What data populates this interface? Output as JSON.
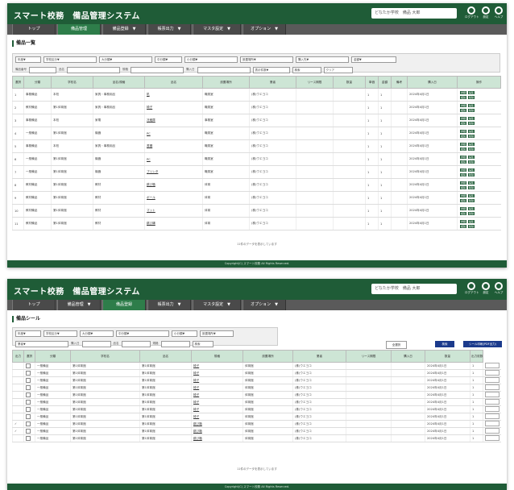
{
  "colors": {
    "header": "#1f5c37",
    "nav": "#5a5a5a",
    "active_tab": "#2e7d4a",
    "table_header": "#cde5d5"
  },
  "shot1": {
    "app_title": "スマート校務　備品管理システム",
    "user_field": "どなたか学校　備品 大郎",
    "header_icons": [
      {
        "name": "logout-icon",
        "label": "ログアウト"
      },
      {
        "name": "settings-icon",
        "label": "設定"
      },
      {
        "name": "help-icon",
        "label": "ヘルプ"
      }
    ],
    "tabs": [
      {
        "label": "トップ"
      },
      {
        "label": "備品管理",
        "active": true
      },
      {
        "label": "備品登録　▼"
      },
      {
        "label": "帳票出力　▼"
      },
      {
        "label": "マスタ設定　▼"
      },
      {
        "label": "オプション　▼"
      }
    ],
    "page_title": "備品一覧",
    "filters_row1": [
      "年度▼",
      "学校区分▼",
      "大分類▼",
      "中分類▼",
      "小分類▼",
      "設置場所▼",
      "購入先▼",
      "金額▼"
    ],
    "filters_row2": [
      "備品番号",
      "品名",
      "規格",
      "購入日",
      "表示件数▼",
      "検索",
      "クリア"
    ],
    "columns": [
      "選択",
      "分類",
      "学校名",
      "品名/規格",
      "品名",
      "設置場所",
      "業者",
      "リース期限",
      "数量",
      "単価",
      "金額",
      "備考",
      "購入日",
      "操作"
    ],
    "rows": [
      {
        "no": "1",
        "cat": "事務備品",
        "school": "本校",
        "model": "家具・事務用品",
        "name": "机",
        "place": "職員室",
        "vendor": "(株)ウエヨコ",
        "qty": "1",
        "price": "1",
        "date": "2024年4月1日"
      },
      {
        "no": "2",
        "cat": "教材備品",
        "school": "第1体育館",
        "model": "家具・事務用品",
        "name": "椅子",
        "place": "職員室",
        "vendor": "(株)ウエヨコ",
        "qty": "1",
        "price": "1",
        "date": "2024年4月1日"
      },
      {
        "no": "3",
        "cat": "事務備品",
        "school": "本校",
        "model": "家電",
        "name": "冷蔵庫",
        "place": "事務室",
        "vendor": "(株)ウエヨコ",
        "qty": "1",
        "price": "1",
        "date": "2024年4月1日"
      },
      {
        "no": "4",
        "cat": "一般備品",
        "school": "第1体育館",
        "model": "機器",
        "name": "PC",
        "place": "職員室",
        "vendor": "(株)ウエヨコ",
        "qty": "1",
        "price": "1",
        "date": "2024年4月1日"
      },
      {
        "no": "5",
        "cat": "事務備品",
        "school": "本校",
        "model": "家具・事務用品",
        "name": "書棚",
        "place": "職員室",
        "vendor": "(株)ウエヨコ",
        "qty": "1",
        "price": "1",
        "date": "2024年4月1日"
      },
      {
        "no": "6",
        "cat": "一般備品",
        "school": "第1体育館",
        "model": "機器",
        "name": "PC",
        "place": "職員室",
        "vendor": "(株)ウエヨコ",
        "qty": "1",
        "price": "1",
        "date": "2024年4月1日"
      },
      {
        "no": "7",
        "cat": "一般備品",
        "school": "第1体育館",
        "model": "機器",
        "name": "プリンタ",
        "place": "職員室",
        "vendor": "(株)ウエヨコ",
        "qty": "1",
        "price": "1",
        "date": "2024年4月1日"
      },
      {
        "no": "8",
        "cat": "教材備品",
        "school": "第1体育館",
        "model": "教材",
        "name": "跳び箱",
        "place": "体育",
        "vendor": "(株)ウエヨコ",
        "qty": "1",
        "price": "1",
        "date": "2024年4月1日"
      },
      {
        "no": "9",
        "cat": "教材備品",
        "school": "第1体育館",
        "model": "教材",
        "name": "ボール",
        "place": "体育",
        "vendor": "(株)ウエヨコ",
        "qty": "1",
        "price": "1",
        "date": "2024年4月1日"
      },
      {
        "no": "10",
        "cat": "教材備品",
        "school": "第1体育館",
        "model": "教材",
        "name": "マット",
        "place": "体育",
        "vendor": "(株)ウエヨコ",
        "qty": "1",
        "price": "1",
        "date": "2024年4月1日"
      },
      {
        "no": "11",
        "cat": "教材備品",
        "school": "第1体育館",
        "model": "教材",
        "name": "跳び縄",
        "place": "体育",
        "vendor": "(株)ウエヨコ",
        "qty": "1",
        "price": "1",
        "date": "2024年4月1日"
      }
    ],
    "row_buttons": [
      "詳細",
      "編集",
      "複製",
      "削除"
    ],
    "count_text": "11件のデータを表示しています",
    "footer": "Copyright(C) スマート校務 All Rights Reserved."
  },
  "shot2": {
    "app_title": "スマート校務　備品管理システム",
    "user_field": "どなたか学校　備品 大郎",
    "tabs": [
      {
        "label": "トップ"
      },
      {
        "label": "備品管理　▼"
      },
      {
        "label": "備品登録",
        "active": true
      },
      {
        "label": "帳票出力　▼"
      },
      {
        "label": "マスタ設定　▼"
      },
      {
        "label": "オプション　▼"
      }
    ],
    "page_title": "備品シール",
    "filters_row1": [
      "年度▼",
      "学校区分▼",
      "大分類▼",
      "中分類▼",
      "小分類▼",
      "設置場所▼"
    ],
    "filters_row2": [
      "業者▼",
      "購入日",
      "品名",
      "規格",
      "検索"
    ],
    "action_buttons": {
      "clear": "全選択",
      "search": "検索",
      "print": "シール印刷(PDF出力)"
    },
    "columns": [
      "出力",
      "選択",
      "分類",
      "学校名",
      "品名",
      "規格",
      "設置場所",
      "業者",
      "リース期限",
      "購入日",
      "数量",
      "出力枚数"
    ],
    "rows": [
      {
        "sel": "",
        "cat": "一般備品",
        "school": "第1体育館",
        "model": "第1体育館",
        "name": "椅子",
        "place": "体育館",
        "vendor": "(株)ウエヨコ",
        "date": "2024年4月1日",
        "qty": "1"
      },
      {
        "sel": "",
        "cat": "一般備品",
        "school": "第1体育館",
        "model": "第1体育館",
        "name": "椅子",
        "place": "体育館",
        "vendor": "(株)ウエヨコ",
        "date": "2024年4月1日",
        "qty": "1"
      },
      {
        "sel": "",
        "cat": "一般備品",
        "school": "第1体育館",
        "model": "第1体育館",
        "name": "椅子",
        "place": "体育館",
        "vendor": "(株)ウエヨコ",
        "date": "2024年4月1日",
        "qty": "1"
      },
      {
        "sel": "",
        "cat": "一般備品",
        "school": "第1体育館",
        "model": "第1体育館",
        "name": "椅子",
        "place": "体育館",
        "vendor": "(株)ウエヨコ",
        "date": "2024年4月1日",
        "qty": "1"
      },
      {
        "sel": "",
        "cat": "一般備品",
        "school": "第1体育館",
        "model": "第1体育館",
        "name": "椅子",
        "place": "体育館",
        "vendor": "(株)ウエヨコ",
        "date": "2024年4月1日",
        "qty": "1"
      },
      {
        "sel": "",
        "cat": "一般備品",
        "school": "第1体育館",
        "model": "第1体育館",
        "name": "椅子",
        "place": "体育館",
        "vendor": "(株)ウエヨコ",
        "date": "2024年4月1日",
        "qty": "1"
      },
      {
        "sel": "",
        "cat": "一般備品",
        "school": "第1体育館",
        "model": "第1体育館",
        "name": "椅子",
        "place": "体育館",
        "vendor": "(株)ウエヨコ",
        "date": "2024年4月1日",
        "qty": "1"
      },
      {
        "sel": "",
        "cat": "一般備品",
        "school": "第1体育館",
        "model": "第1体育館",
        "name": "椅子",
        "place": "体育館",
        "vendor": "(株)ウエヨコ",
        "date": "2024年4月1日",
        "qty": "1"
      },
      {
        "sel": "✓",
        "cat": "一般備品",
        "school": "第1体育館",
        "model": "第1体育館",
        "name": "跳び箱",
        "place": "体育館",
        "vendor": "(株)ウエヨコ",
        "date": "2024年4月1日",
        "qty": "1"
      },
      {
        "sel": "✓",
        "cat": "一般備品",
        "school": "第1体育館",
        "model": "第1体育館",
        "name": "跳び箱",
        "place": "体育館",
        "vendor": "(株)ウエヨコ",
        "date": "2024年4月1日",
        "qty": "1"
      },
      {
        "sel": "",
        "cat": "一般備品",
        "school": "第1体育館",
        "model": "第1体育館",
        "name": "跳び箱",
        "place": "体育館",
        "vendor": "(株)ウエヨコ",
        "date": "2024年4月1日",
        "qty": "1"
      }
    ],
    "count_text": "11件のデータを表示しています",
    "footer": "Copyright(C) スマート校務 All Rights Reserved."
  }
}
